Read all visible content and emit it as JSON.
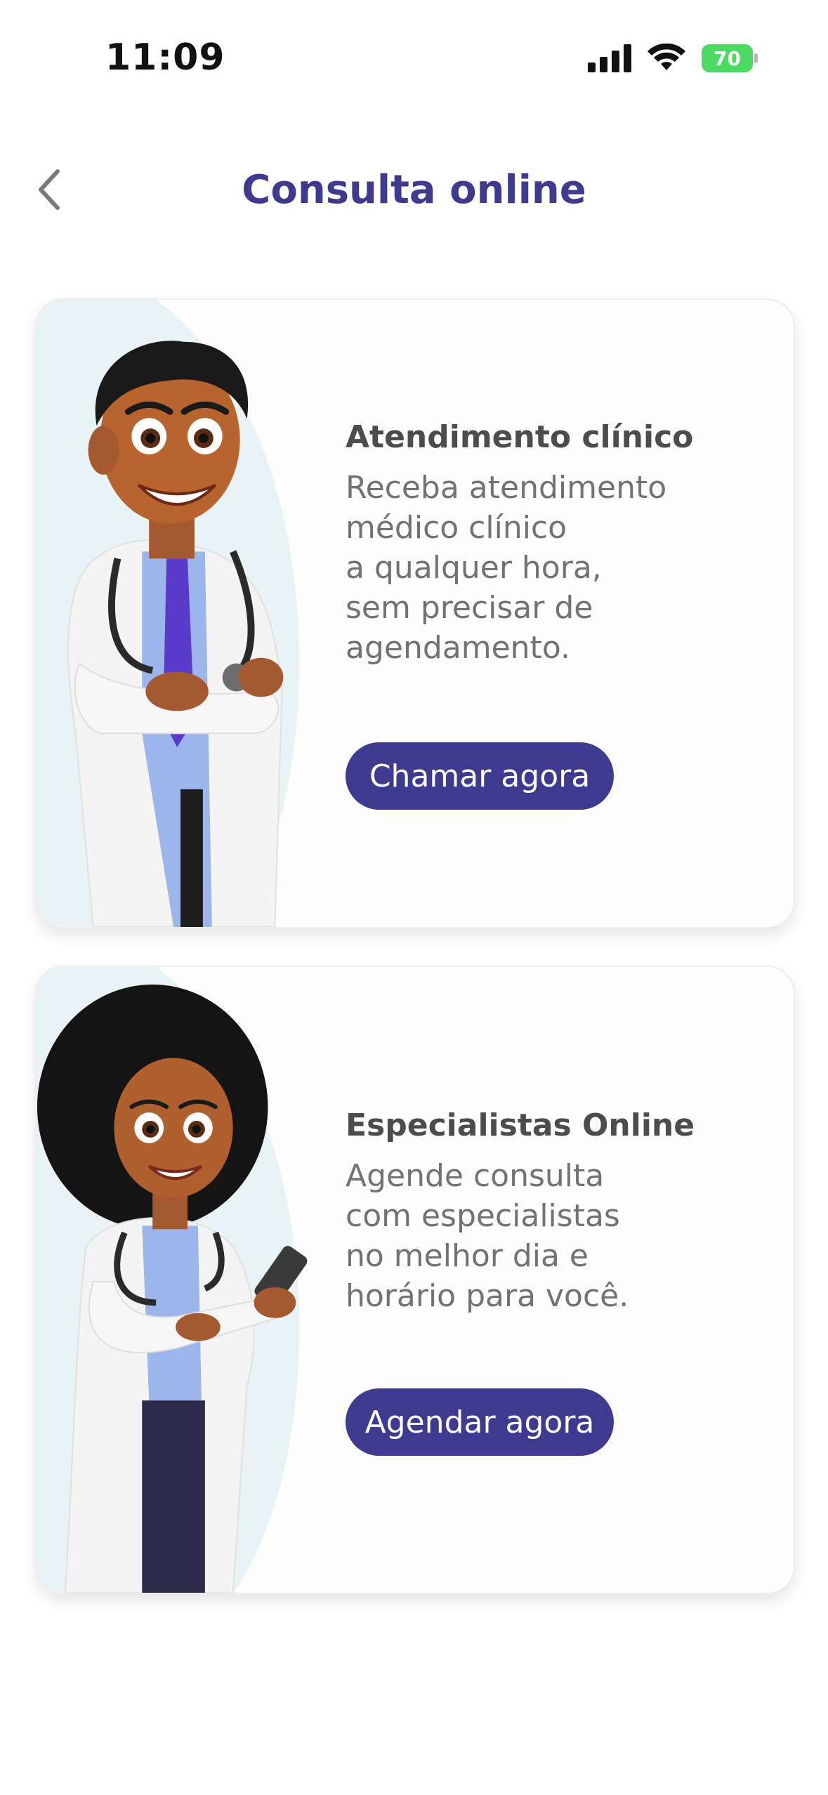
{
  "status_bar": {
    "time": "11:09",
    "battery": "70"
  },
  "header": {
    "title": "Consulta online",
    "back_icon": "chevron-left-icon"
  },
  "cards": [
    {
      "title": "Atendimento clínico",
      "description": "Receba atendimento\nmédico clínico\na qualquer hora,\n sem precisar de\nagendamento.",
      "button_label": "Chamar agora",
      "image": "male-doctor-illustration"
    },
    {
      "title": "Especialistas Online",
      "description": "Agende consulta\ncom especialistas\nno melhor dia e\nhorário para você.",
      "button_label": "Agendar agora",
      "image": "female-doctor-illustration"
    }
  ],
  "colors": {
    "primary": "#3d3a8f",
    "title_text": "#4c4c4c",
    "body_text": "#727272",
    "battery": "#4cd964"
  }
}
